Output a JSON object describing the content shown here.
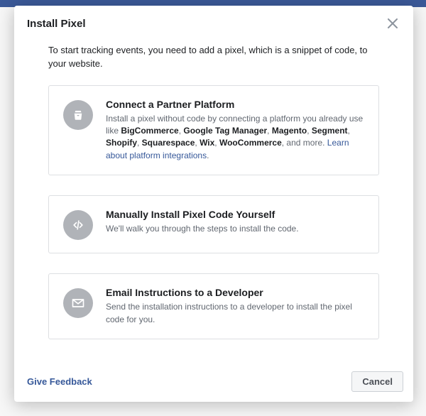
{
  "modal": {
    "title": "Install Pixel",
    "intro": "To start tracking events, you need to add a pixel, which is a snippet of code, to your website.",
    "options": [
      {
        "title": "Connect a Partner Platform",
        "desc_before": "Install a pixel without code by connecting a platform you already use like ",
        "platforms": [
          "BigCommerce",
          "Google Tag Manager",
          "Magento",
          "Segment",
          "Shopify",
          "Squarespace",
          "Wix",
          "WooCommerce"
        ],
        "desc_mid": ", and more. ",
        "link_text": "Learn about platform integrations",
        "desc_after": "."
      },
      {
        "title": "Manually Install Pixel Code Yourself",
        "desc": "We'll walk you through the steps to install the code."
      },
      {
        "title": "Email Instructions to a Developer",
        "desc": "Send the installation instructions to a developer to install the pixel code for you."
      }
    ],
    "footer": {
      "feedback": "Give Feedback",
      "cancel": "Cancel"
    }
  }
}
